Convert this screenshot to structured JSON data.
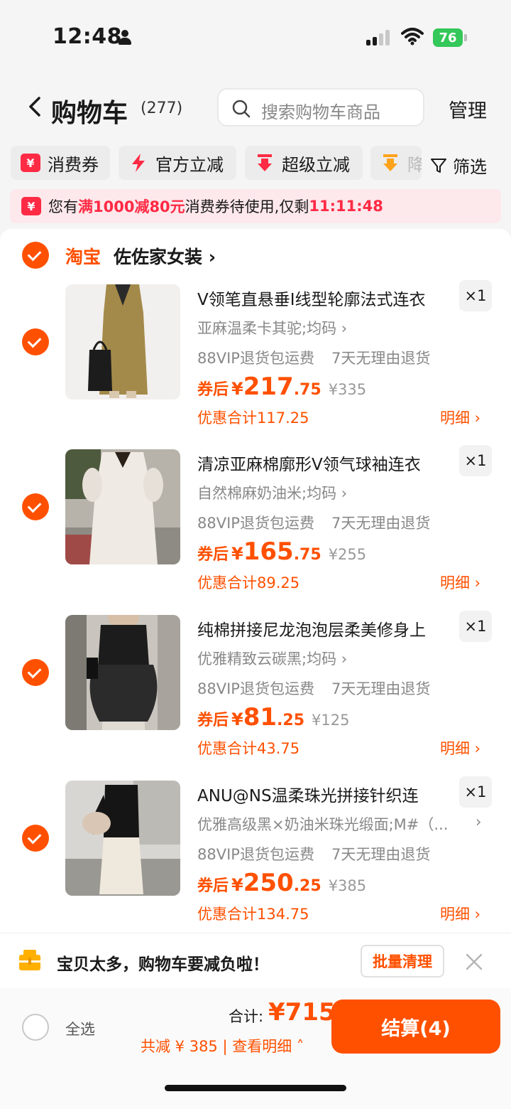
{
  "status_bar": {
    "time": "12:48",
    "battery": "76"
  },
  "header": {
    "title": "购物车",
    "count": "(277)",
    "search_placeholder": "搜索购物车商品",
    "manage": "管理"
  },
  "filters": {
    "chips": [
      {
        "label": "消费券",
        "icon": "yen-coupon-icon"
      },
      {
        "label": "官方立减",
        "icon": "lightning-icon"
      },
      {
        "label": "超级立减",
        "icon": "arrow-down-icon"
      },
      {
        "label": "降",
        "icon": "price-drop-icon"
      }
    ],
    "filter_label": "筛选"
  },
  "coupon_banner": {
    "prefix": "您有",
    "highlight": "满1000减80元",
    "middle": "消费券待使用,仅剩",
    "countdown": "11:11:48"
  },
  "shop": {
    "platform": "淘宝",
    "name": "佐佐家女装"
  },
  "items": [
    {
      "title": "V领笔直悬垂I线型轮廓法式连衣",
      "qty": "×1",
      "sku": "亚麻温柔卡其驼;均码",
      "tag1": "88VIP退货包运费",
      "tag2": "7天无理由退货",
      "price_prefix": "券后",
      "price_yen": "¥",
      "price_int": "217",
      "price_dec": ".75",
      "price_orig": "¥335",
      "discount": "优惠合计117.25",
      "detail": "明细",
      "colors": {
        "bg": "#ece9e6",
        "main": "#a48a4a"
      }
    },
    {
      "title": "清凉亚麻棉廓形V领气球袖连衣",
      "qty": "×1",
      "sku": "自然棉麻奶油米;均码",
      "tag1": "88VIP退货包运费",
      "tag2": "7天无理由退货",
      "price_prefix": "券后",
      "price_yen": "¥",
      "price_int": "165",
      "price_dec": ".75",
      "price_orig": "¥255",
      "discount": "优惠合计89.25",
      "detail": "明细",
      "colors": {
        "bg": "#b7b2aa",
        "main": "#efeae3"
      }
    },
    {
      "title": "纯棉拼接尼龙泡泡层柔美修身上",
      "qty": "×1",
      "sku": "优雅精致云碳黑;均码",
      "tag1": "88VIP退货包运费",
      "tag2": "7天无理由退货",
      "price_prefix": "券后",
      "price_yen": "¥",
      "price_int": "81",
      "price_dec": ".25",
      "price_orig": "¥125",
      "discount": "优惠合计43.75",
      "detail": "明细",
      "colors": {
        "bg": "#c9c4bd",
        "main": "#1c1c1c"
      }
    },
    {
      "title": "ANU@NS温柔珠光拼接针织连",
      "qty": "×1",
      "sku": "优雅高级黑×奶油米珠光缎面;M#（...",
      "tag1": "88VIP退货包运费",
      "tag2": "7天无理由退货",
      "price_prefix": "券后",
      "price_yen": "¥",
      "price_int": "250",
      "price_dec": ".25",
      "price_orig": "¥385",
      "discount": "优惠合计134.75",
      "detail": "明细",
      "colors": {
        "bg": "#d8d6d2",
        "main": "#151515"
      }
    }
  ],
  "tip_bar": {
    "text": "宝贝太多，购物车要减负啦！",
    "button": "批量清理"
  },
  "bottom_bar": {
    "select_all": "全选",
    "total_label": "合计:",
    "total_value": "¥715",
    "saved": "共减 ¥ 385 | 查看明细",
    "checkout": "结算(4)"
  },
  "accent_color": "#ff5000",
  "highlight_color": "#ff2a44"
}
